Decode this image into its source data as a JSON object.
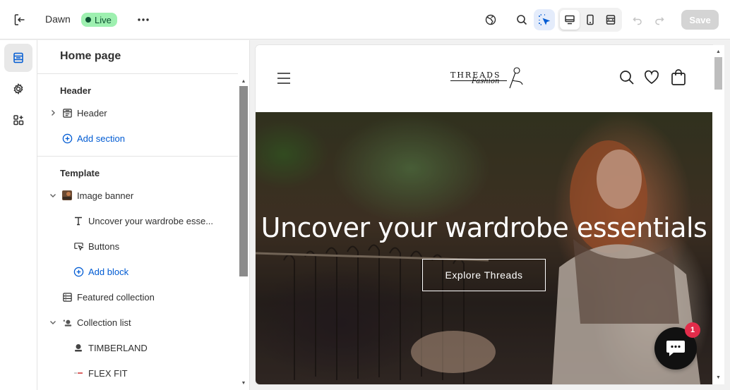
{
  "topbar": {
    "theme_name": "Dawn",
    "status_label": "Live",
    "save_label": "Save",
    "icons": [
      "exit-icon",
      "more-icon",
      "globe-icon",
      "search-icon",
      "inspect-icon",
      "desktop-icon",
      "mobile-icon",
      "fullscreen-icon",
      "undo-icon",
      "redo-icon"
    ]
  },
  "rail": {
    "icons": [
      "sections-icon",
      "theme-settings-icon",
      "apps-icon"
    ]
  },
  "sidebar": {
    "title": "Home page",
    "header_group": {
      "heading": "Header",
      "items": [
        {
          "label": "Header",
          "icon": "header-section-icon"
        },
        {
          "label": "Add section",
          "icon": "add-circle-icon"
        }
      ]
    },
    "template_group": {
      "heading": "Template",
      "items": [
        {
          "label": "Image banner",
          "icon": "image-thumbnail-icon"
        },
        {
          "label": "Uncover your wardrobe esse...",
          "icon": "text-icon"
        },
        {
          "label": "Buttons",
          "icon": "button-icon"
        },
        {
          "label": "Add block",
          "icon": "add-circle-icon"
        },
        {
          "label": "Featured collection",
          "icon": "collection-icon"
        },
        {
          "label": "Collection list",
          "icon": "collection-list-icon"
        },
        {
          "label": "TIMBERLAND",
          "icon": "brand-thumbnail-icon"
        },
        {
          "label": "FLEX FIT",
          "icon": "brand-thumbnail-icon"
        }
      ]
    }
  },
  "preview": {
    "logo_text": "THREADS",
    "logo_script": "Fashion",
    "hero_title": "Uncover your wardrobe essentials",
    "hero_button": "Explore Threads",
    "chat_badge": "1",
    "icons": [
      "menu-icon",
      "search-icon",
      "wishlist-icon",
      "cart-icon",
      "chat-icon"
    ]
  },
  "colors": {
    "accent": "#005bd3",
    "live_badge": "#9ef0b0",
    "notification": "#e22c4a"
  }
}
